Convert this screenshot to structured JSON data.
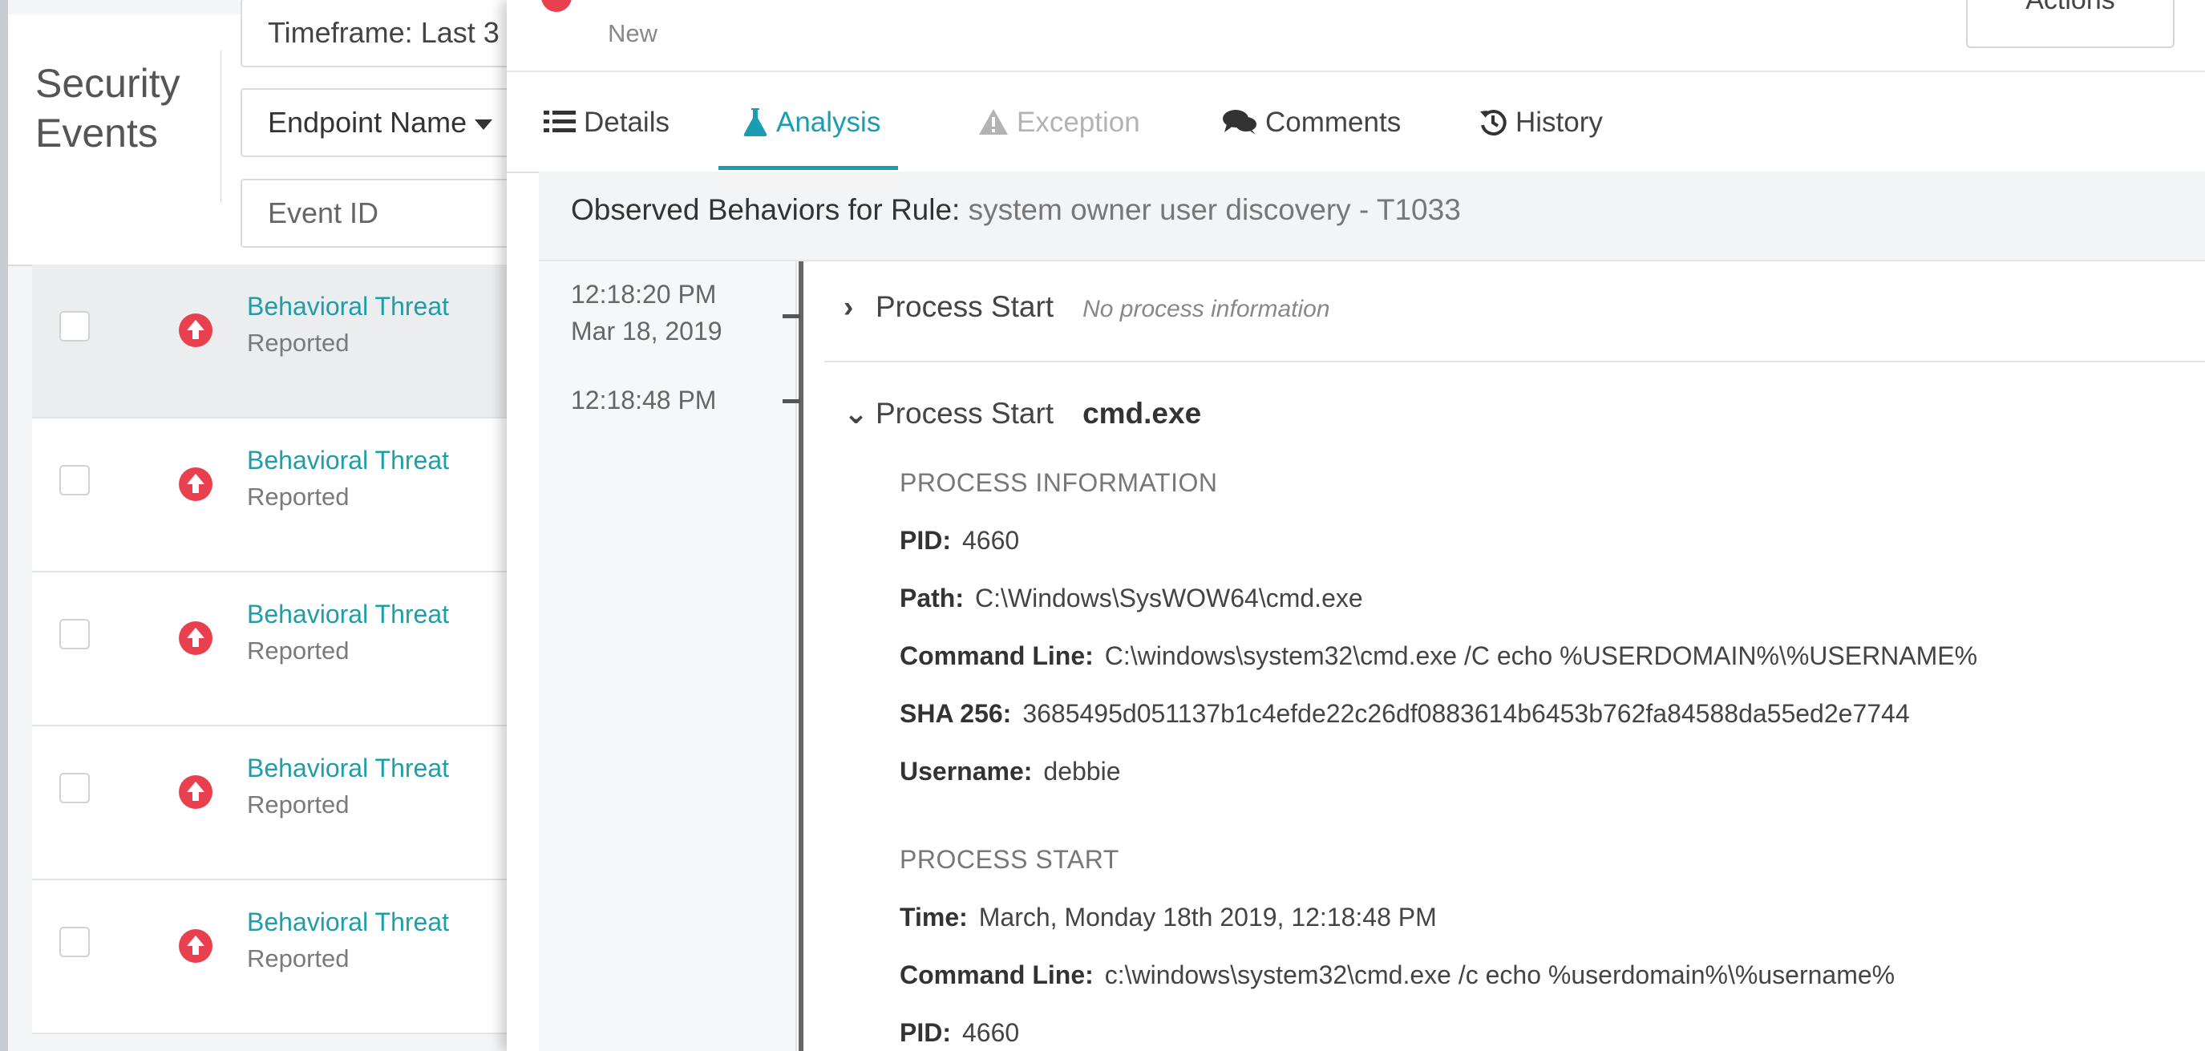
{
  "left_panel": {
    "title": "Security Events",
    "filters": {
      "timeframe": "Timeframe: Last 3",
      "endpoint": "Endpoint Name",
      "event_id_placeholder": "Event ID"
    },
    "events": [
      {
        "title": "Behavioral Threat",
        "status": "Reported"
      },
      {
        "title": "Behavioral Threat",
        "status": "Reported"
      },
      {
        "title": "Behavioral Threat",
        "status": "Reported"
      },
      {
        "title": "Behavioral Threat",
        "status": "Reported"
      },
      {
        "title": "Behavioral Threat",
        "status": "Reported"
      }
    ]
  },
  "drawer": {
    "status_label": "New",
    "actions_label": "Actions",
    "tabs": [
      {
        "label": "Details",
        "icon": "list-icon",
        "state": "normal"
      },
      {
        "label": "Analysis",
        "icon": "flask-icon",
        "state": "active"
      },
      {
        "label": "Exception",
        "icon": "warning-icon",
        "state": "disabled"
      },
      {
        "label": "Comments",
        "icon": "comments-icon",
        "state": "normal"
      },
      {
        "label": "History",
        "icon": "history-icon",
        "state": "normal"
      }
    ],
    "rule_bar": {
      "prefix": "Observed Behaviors for Rule:",
      "rule": "system owner user discovery - T1033"
    },
    "timeline": [
      {
        "time": "12:18:20 PM",
        "date": "Mar 18, 2019",
        "title": "Process Start",
        "note": "No process information",
        "expanded": false
      },
      {
        "time": "12:18:48 PM",
        "title": "Process Start",
        "process": "cmd.exe",
        "expanded": true,
        "process_information": {
          "heading": "PROCESS INFORMATION",
          "pid_label": "PID:",
          "pid": "4660",
          "path_label": "Path:",
          "path": "C:\\Windows\\SysWOW64\\cmd.exe",
          "cmd_label": "Command Line:",
          "cmd": "C:\\windows\\system32\\cmd.exe /C echo %USERDOMAIN%\\%USERNAME%",
          "sha_label": "SHA 256:",
          "sha": "3685495d051137b1c4efde22c26df0883614b6453b762fa84588da55ed2e7744",
          "user_label": "Username:",
          "user": "debbie"
        },
        "process_start": {
          "heading": "PROCESS START",
          "time_label": "Time:",
          "time": "March, Monday 18th 2019, 12:18:48 PM",
          "cmd_label": "Command Line:",
          "cmd": "c:\\windows\\system32\\cmd.exe /c echo %userdomain%\\%username%",
          "pid_label": "PID:",
          "pid": "4660"
        }
      }
    ]
  },
  "colors": {
    "accent": "#1a9db3",
    "link": "#1f9ea8",
    "threat": "#e8404f"
  }
}
